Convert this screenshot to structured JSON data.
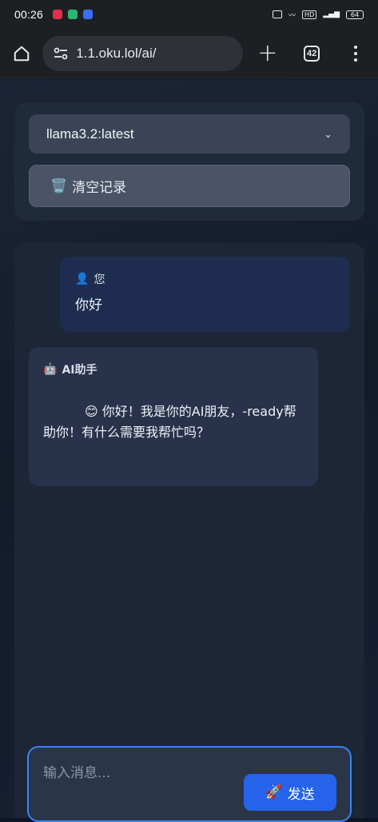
{
  "status_bar": {
    "time": "00:26",
    "battery": "64",
    "app_colors": [
      "#e0304e",
      "#2bb673",
      "#3b6ef5"
    ]
  },
  "browser": {
    "url": "1.1.oku.lol/ai/",
    "tab_count": "42",
    "new_tab_icon": "plus-icon",
    "menu_icon": "more-vert-icon",
    "home_icon": "home-icon"
  },
  "controls": {
    "model_selected": "llama3.2:latest",
    "clear_emoji": "🗑️",
    "clear_label": "清空记录"
  },
  "messages": [
    {
      "role": "user",
      "icon": "👤",
      "author": "您",
      "text": "你好"
    },
    {
      "role": "ai",
      "icon": "🤖",
      "author": "AI助手",
      "text": "😊 你好！我是你的AI朋友，-ready帮助你！有什么需要我帮忙吗？"
    }
  ],
  "composer": {
    "placeholder": "输入消息...",
    "send_emoji": "🚀",
    "send_label": "发送"
  },
  "colors": {
    "accent": "#2563eb",
    "focus_border": "#3b82f6",
    "user_bubble": "#1e2d4f",
    "ai_bubble": "#28324a"
  }
}
